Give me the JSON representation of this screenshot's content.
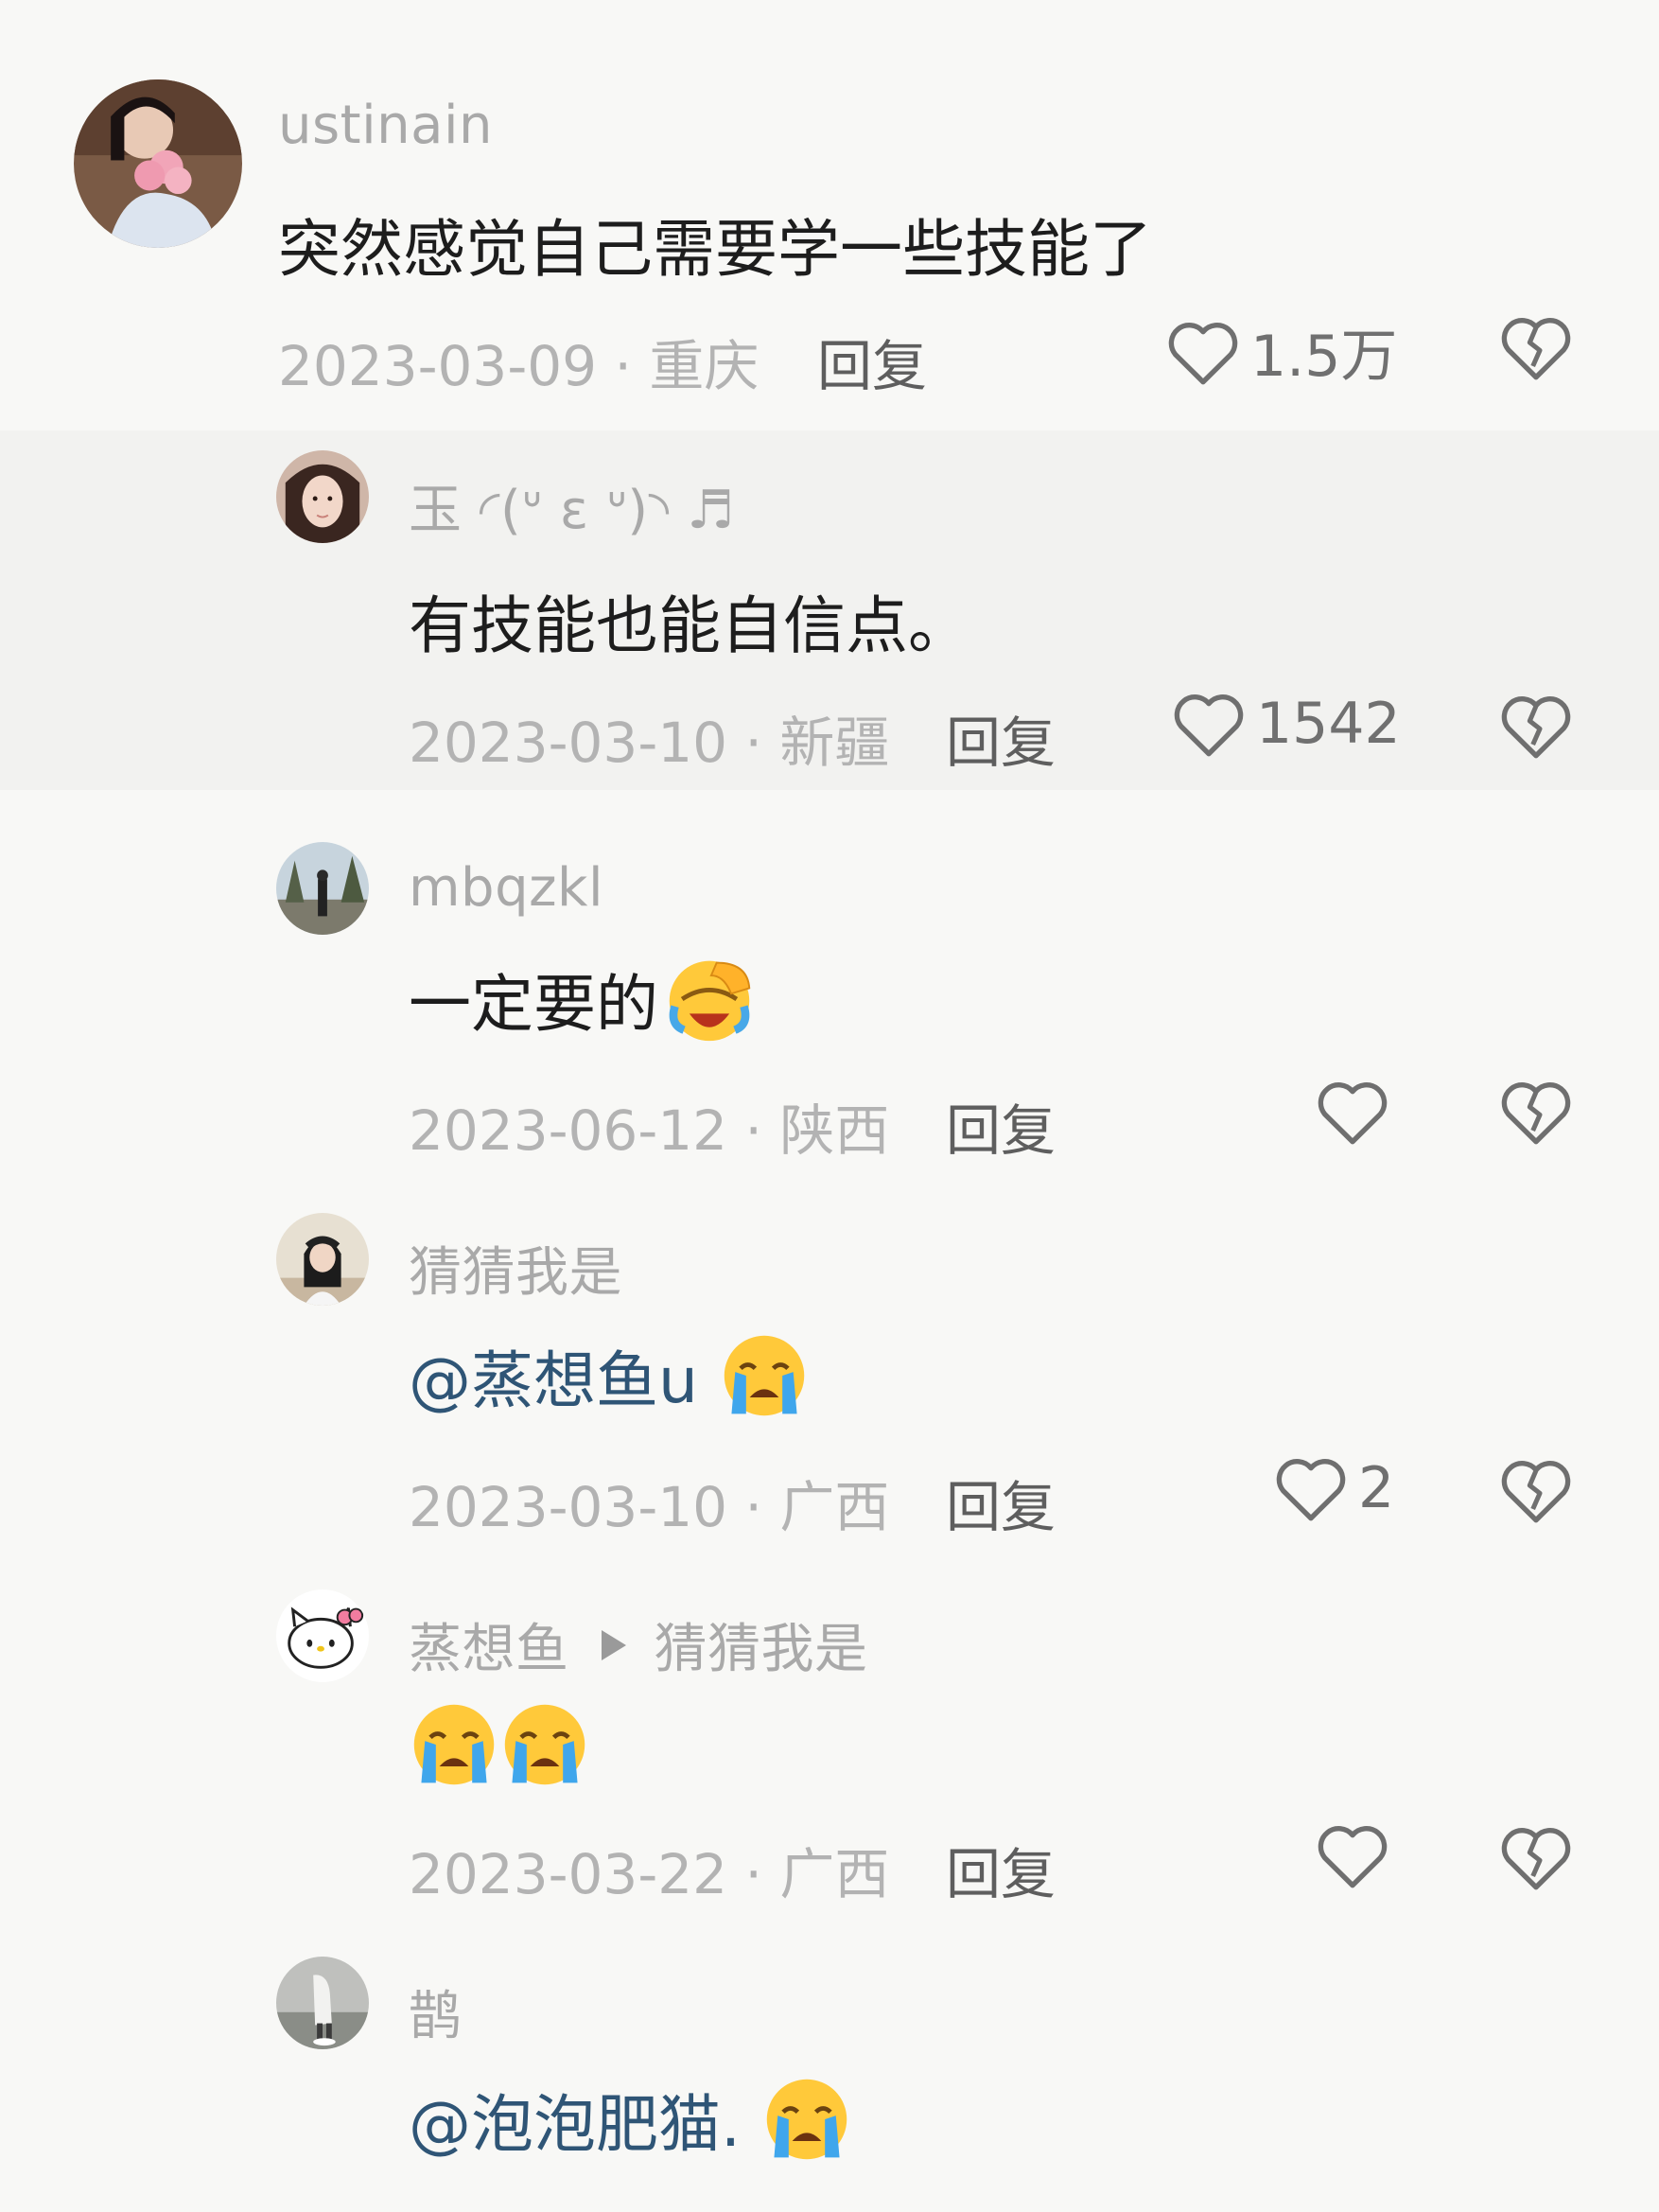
{
  "colors": {
    "background": "#f8f8f6",
    "username": "#a9a9a9",
    "meta": "#b3b3b3",
    "reply": "#5e5e5e",
    "mention": "#2f5576",
    "icon_stroke": "#6f6f6f"
  },
  "comments": [
    {
      "username": "ustinain",
      "text": "突然感觉自己需要学一些技能了",
      "date_location": "2023-03-09 · 重庆",
      "reply_label": "回复",
      "likes": "1.5万",
      "avatar_icon": "avatar-woman-flowers-icon"
    },
    {
      "username": "玉 ◜(ᐡ ε ᐡ)◝ ♬",
      "text": "有技能也能自信点。",
      "date_location": "2023-03-10 · 新疆",
      "reply_label": "回复",
      "likes": "1542",
      "avatar_icon": "avatar-woman-portrait-icon"
    },
    {
      "username": "mbqzkl",
      "text": "一定要的",
      "date_location": "2023-06-12 · 陕西",
      "reply_label": "回复",
      "likes": "",
      "avatar_icon": "avatar-tree-person-icon",
      "emoji": "facepalm-laugh-emoji"
    },
    {
      "username": "猜猜我是",
      "text": "@蒸想鱼u",
      "date_location": "2023-03-10 · 广西",
      "reply_label": "回复",
      "likes": "2",
      "avatar_icon": "avatar-girl-photo-icon",
      "emoji": "crying-face-emoji"
    },
    {
      "username": "蒸想鱼",
      "reply_to": "猜猜我是",
      "text": "",
      "date_location": "2023-03-22 · 广西",
      "reply_label": "回复",
      "likes": "",
      "avatar_icon": "avatar-hello-kitty-icon",
      "emoji": "crying-face-emoji"
    },
    {
      "username": "鹊",
      "text": "@泡泡肥猫.",
      "avatar_icon": "avatar-figure-photo-icon",
      "emoji": "crying-face-emoji"
    }
  ]
}
